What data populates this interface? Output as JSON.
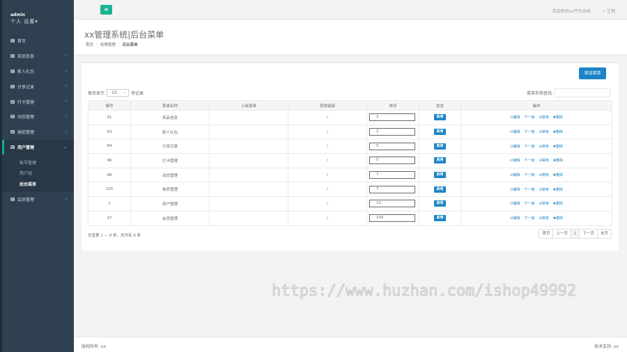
{
  "profile": {
    "name": "admin",
    "role": "个人 设置▾"
  },
  "nav": [
    {
      "label": "首页",
      "chevron": false
    },
    {
      "label": "奖品信息",
      "chevron": true
    },
    {
      "label": "新人礼包",
      "chevron": true
    },
    {
      "label": "分享记录",
      "chevron": true
    },
    {
      "label": "打卡管理",
      "chevron": true
    },
    {
      "label": "动态管理",
      "chevron": true
    },
    {
      "label": "抽奖管理",
      "chevron": true
    }
  ],
  "nav_active": {
    "label": "用户管理",
    "chevron": "⌄"
  },
  "nav_sub": [
    "账号管理",
    "用户组",
    "后台菜单"
  ],
  "nav_after": {
    "label": "会员管理",
    "chevron": "‹"
  },
  "chev": "‹",
  "topbar": {
    "menu": "≡",
    "welcome": "欢迎来到xx平台系统",
    "logout": "⇨ 注销"
  },
  "header": {
    "title": "xx管理系统|后台菜单",
    "crumbs": [
      "首页",
      "权限管理",
      "后台菜单"
    ],
    "crumb_sep": "|"
  },
  "panel": {
    "add_button": "添加菜单",
    "length_prefix": "每页显示",
    "length_value": "10",
    "length_arrow": "⌄",
    "length_suffix": "项记录",
    "search_label": "菜单名称查找:",
    "columns": [
      "编号",
      "菜单名称",
      "上级菜单",
      "菜单链接",
      "排序",
      "状态",
      "操作"
    ],
    "rows": [
      {
        "id": "91",
        "name": "奖品信息",
        "parent": "",
        "link": "/",
        "order": "2",
        "status": "启用"
      },
      {
        "id": "93",
        "name": "新人礼包",
        "parent": "",
        "link": "/",
        "order": "2",
        "status": "启用"
      },
      {
        "id": "84",
        "name": "分享记录",
        "parent": "",
        "link": "/",
        "order": "5",
        "status": "启用"
      },
      {
        "id": "96",
        "name": "打卡管理",
        "parent": "",
        "link": "/",
        "order": "5",
        "status": "启用"
      },
      {
        "id": "98",
        "name": "动态管理",
        "parent": "",
        "link": "/",
        "order": "7",
        "status": "启用"
      },
      {
        "id": "100",
        "name": "抽奖管理",
        "parent": "",
        "link": "/",
        "order": "7",
        "status": "启用"
      },
      {
        "id": "1",
        "name": "用户管理",
        "parent": "",
        "link": "/",
        "order": "10",
        "status": "启用"
      },
      {
        "id": "37",
        "name": "会员管理",
        "parent": "",
        "link": "/",
        "order": "100",
        "status": "启用"
      }
    ],
    "ops": [
      "☑编辑",
      "下一级",
      "⊘禁用",
      "✖删除"
    ],
    "info": "总显第 1 — 8 条，总共有 8 条",
    "pager": [
      "首页",
      "上一页",
      "1",
      "下一页",
      "末页"
    ]
  },
  "watermark": "https://www.huzhan.com/ishop49992",
  "footer": {
    "left": "版权所有 :xx",
    "right": "技术支持: xx"
  }
}
